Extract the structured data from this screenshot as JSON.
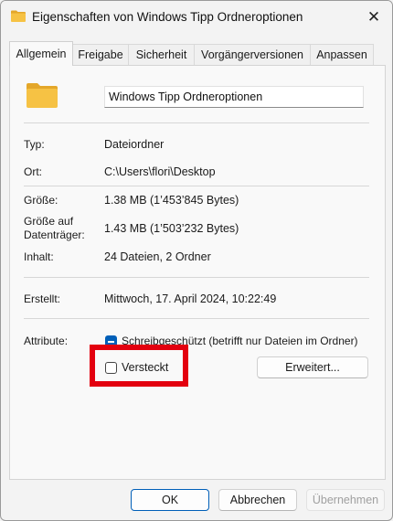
{
  "window": {
    "title": "Eigenschaften von Windows Tipp Ordneroptionen",
    "close_glyph": "✕"
  },
  "tabs": [
    {
      "label": "Allgemein",
      "active": true
    },
    {
      "label": "Freigabe",
      "active": false
    },
    {
      "label": "Sicherheit",
      "active": false
    },
    {
      "label": "Vorgängerversionen",
      "active": false
    },
    {
      "label": "Anpassen",
      "active": false
    }
  ],
  "general": {
    "folder_name": "Windows Tipp Ordneroptionen",
    "folder_icon": "folder-icon",
    "type": {
      "label": "Typ:",
      "value": "Dateiordner"
    },
    "location": {
      "label": "Ort:",
      "value": "C:\\Users\\flori\\Desktop"
    },
    "size": {
      "label": "Größe:",
      "value": "1.38 MB (1’453’845 Bytes)"
    },
    "size_on_disk": {
      "label_line1": "Größe auf",
      "label_line2": "Datenträger:",
      "value": "1.43 MB (1’503’232 Bytes)"
    },
    "contents": {
      "label": "Inhalt:",
      "value": "24 Dateien, 2 Ordner"
    },
    "created": {
      "label": "Erstellt:",
      "value": "Mittwoch, 17. April 2024, 10:22:49"
    },
    "attributes": {
      "label": "Attribute:",
      "readonly_label": "Schreibgeschützt (betrifft nur Dateien im Ordner)",
      "readonly_state": "indeterminate",
      "hidden_label": "Versteckt",
      "hidden_checked": false,
      "advanced_button": "Erweitert..."
    }
  },
  "footer": {
    "ok": "OK",
    "cancel": "Abbrechen",
    "apply": "Übernehmen"
  },
  "colors": {
    "accent": "#005fb8",
    "highlight": "#e3000f",
    "folder": "#f6c244"
  }
}
